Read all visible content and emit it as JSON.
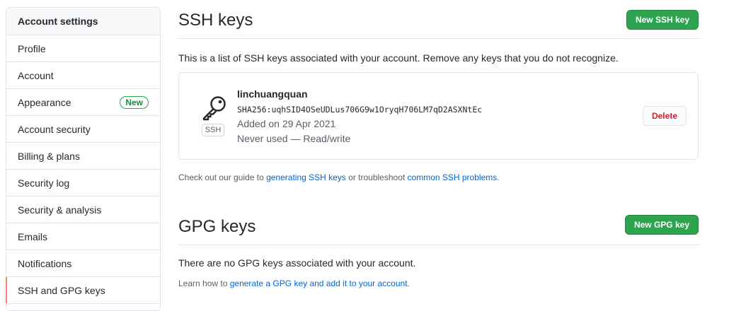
{
  "sidebar": {
    "header": "Account settings",
    "items": [
      {
        "label": "Profile"
      },
      {
        "label": "Account"
      },
      {
        "label": "Appearance",
        "badge": "New"
      },
      {
        "label": "Account security"
      },
      {
        "label": "Billing & plans"
      },
      {
        "label": "Security log"
      },
      {
        "label": "Security & analysis"
      },
      {
        "label": "Emails"
      },
      {
        "label": "Notifications"
      },
      {
        "label": "SSH and GPG keys",
        "selected": true
      }
    ]
  },
  "ssh": {
    "title": "SSH keys",
    "new_button": "New SSH key",
    "description": "This is a list of SSH keys associated with your account. Remove any keys that you do not recognize.",
    "key": {
      "name": "linchuangquan",
      "fingerprint": "SHA256:uqhSID4OSeUDLus706G9w1OryqH706LM7qD2ASXNtEc",
      "added": "Added on 29 Apr 2021",
      "usage": "Never used — Read/write",
      "type_badge": "SSH",
      "delete_button": "Delete"
    },
    "guide": {
      "prefix": "Check out our guide to ",
      "link1": "generating SSH keys",
      "middle": " or troubleshoot ",
      "link2": "common SSH problems",
      "suffix": "."
    }
  },
  "gpg": {
    "title": "GPG keys",
    "new_button": "New GPG key",
    "empty_text": "There are no GPG keys associated with your account.",
    "learn": {
      "prefix": "Learn how to ",
      "link": "generate a GPG key and add it to your account",
      "suffix": "."
    }
  },
  "colors": {
    "primary_button": "#2ea44f",
    "danger_text": "#cb2431",
    "link": "#0366d6",
    "selected_indicator": "#f9826c"
  },
  "icons": {
    "key": "key-icon"
  }
}
